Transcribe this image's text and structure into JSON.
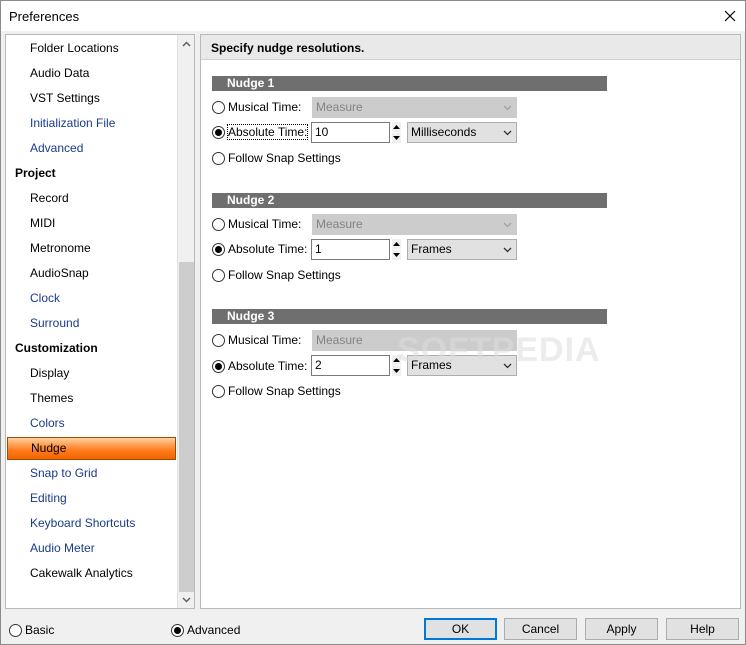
{
  "window": {
    "title": "Preferences"
  },
  "sidebar": {
    "items": [
      {
        "label": "Folder Locations",
        "kind": "plain"
      },
      {
        "label": "Audio Data",
        "kind": "plain"
      },
      {
        "label": "VST Settings",
        "kind": "plain"
      },
      {
        "label": "Initialization File",
        "kind": "link"
      },
      {
        "label": "Advanced",
        "kind": "link"
      },
      {
        "label": "Project",
        "kind": "section"
      },
      {
        "label": "Record",
        "kind": "plain"
      },
      {
        "label": "MIDI",
        "kind": "plain"
      },
      {
        "label": "Metronome",
        "kind": "plain"
      },
      {
        "label": "AudioSnap",
        "kind": "plain"
      },
      {
        "label": "Clock",
        "kind": "link"
      },
      {
        "label": "Surround",
        "kind": "link"
      },
      {
        "label": "Customization",
        "kind": "section"
      },
      {
        "label": "Display",
        "kind": "plain"
      },
      {
        "label": "Themes",
        "kind": "plain"
      },
      {
        "label": "Colors",
        "kind": "link"
      },
      {
        "label": "Nudge",
        "kind": "selected"
      },
      {
        "label": "Snap to Grid",
        "kind": "link"
      },
      {
        "label": "Editing",
        "kind": "link"
      },
      {
        "label": "Keyboard Shortcuts",
        "kind": "link"
      },
      {
        "label": "Audio Meter",
        "kind": "link"
      },
      {
        "label": "Cakewalk Analytics",
        "kind": "plain"
      }
    ]
  },
  "panel": {
    "header": "Specify nudge resolutions.",
    "groups": [
      {
        "title": "Nudge 1",
        "musical_label": "Musical Time:",
        "musical_value": "Measure",
        "absolute_label": "Absolute Time:",
        "absolute_value": "10",
        "unit": "Milliseconds",
        "snap_label": "Follow Snap Settings",
        "selected": "absolute"
      },
      {
        "title": "Nudge 2",
        "musical_label": "Musical Time:",
        "musical_value": "Measure",
        "absolute_label": "Absolute Time:",
        "absolute_value": "1",
        "unit": "Frames",
        "snap_label": "Follow Snap Settings",
        "selected": "absolute"
      },
      {
        "title": "Nudge 3",
        "musical_label": "Musical Time:",
        "musical_value": "Measure",
        "absolute_label": "Absolute Time:",
        "absolute_value": "2",
        "unit": "Frames",
        "snap_label": "Follow Snap Settings",
        "selected": "absolute"
      }
    ]
  },
  "footer": {
    "basic_label": "Basic",
    "advanced_label": "Advanced",
    "ok": "OK",
    "cancel": "Cancel",
    "apply": "Apply",
    "help": "Help"
  },
  "watermark": "SOFTPEDIA",
  "colors": {
    "selected_item": "#ff7b1c",
    "link_text": "#1a3a8a",
    "group_bar": "#6f6f6f",
    "default_button_border": "#0078d7"
  }
}
